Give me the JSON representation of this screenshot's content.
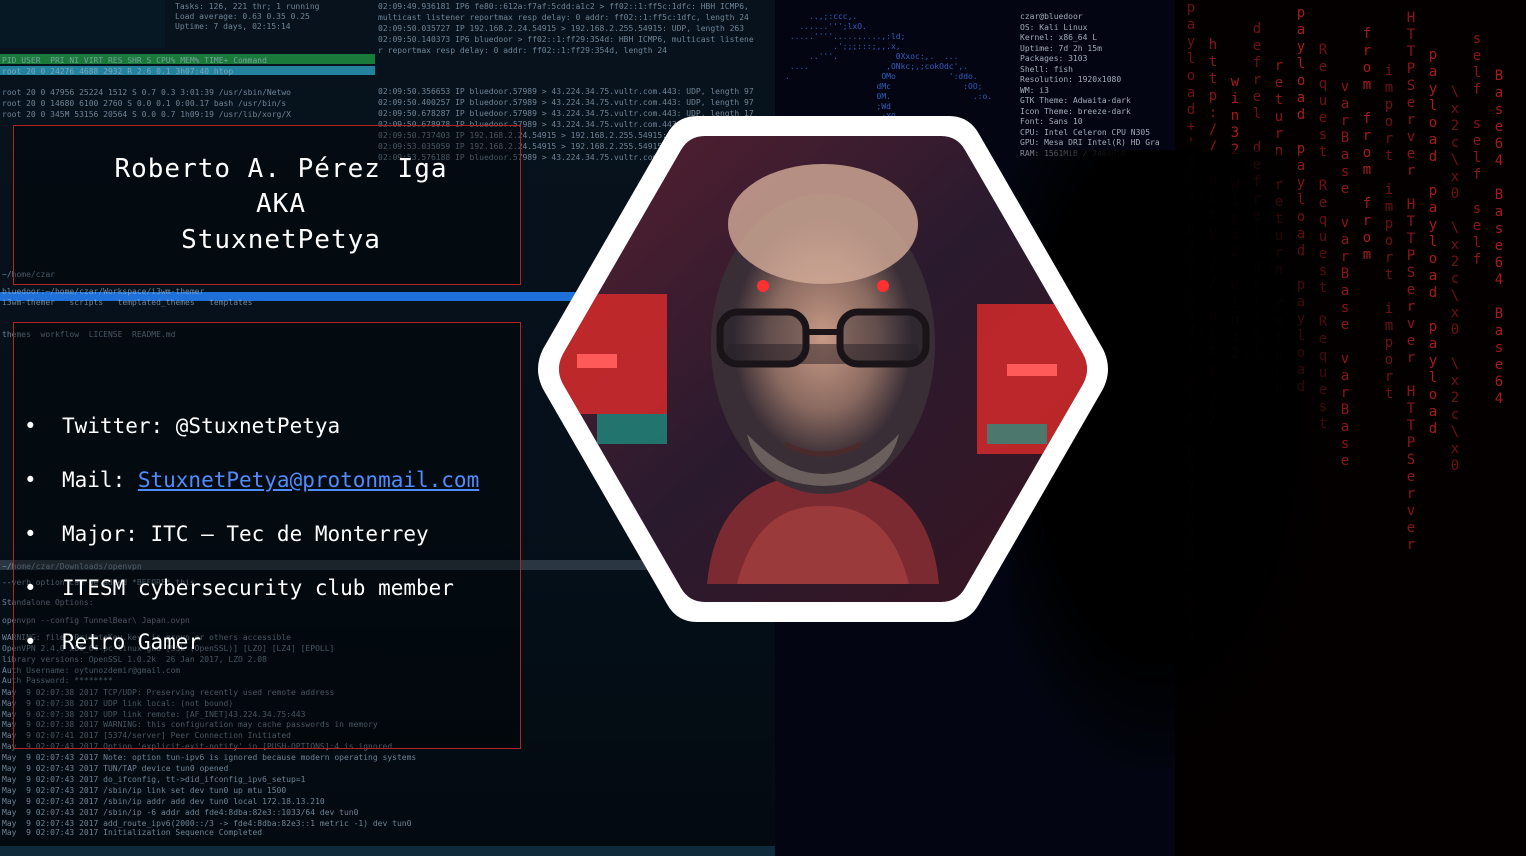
{
  "profile": {
    "name": "Roberto A. Pérez Iga",
    "aka_label": "AKA",
    "alias": "StuxnetPetya"
  },
  "info": [
    {
      "label": "Twitter: @StuxnetPetya",
      "link": ""
    },
    {
      "label": "Mail: ",
      "link": "StuxnetPetya@protonmail.com"
    },
    {
      "label": "Major: ITC – Tec de Monterrey",
      "link": ""
    },
    {
      "label": "ITESM cybersecurity club member",
      "link": ""
    },
    {
      "label": "Retro Gamer",
      "link": ""
    }
  ],
  "avatar": {
    "icon": "hacker-portrait-icon"
  },
  "colors": {
    "frame": "#b12424",
    "link": "#4f8cff",
    "matrix": "#c02020"
  },
  "background": {
    "terminal_lines": [
      "Tasks: 126, 221 thr; 1 running",
      "Load average: 0.63 0.35 0.25",
      "Uptime: 7 days, 02:15:14",
      "PID USER  PRI NI VIRT RES SHR S CPU% MEM% TIME+ Command",
      "root 20 0 24276 4688 2932 R 2.6 0.1 3h07:40 htop",
      "root 20 0 47956 25224 1512 S 0.7 0.3 3:01:39 /usr/sbin/Netwo",
      "root 20 0 14680 6100 2760 S 0.0 0.1 0:00.17 bash /usr/bin/s",
      "root 20 0 345M 53156 20564 S 0.0 0.7 1h09:19 /usr/lib/xorg/X",
      "~/home/czar",
      "bluedoor:~/home/czar/Workspace/i3wm-themer",
      "i3wm-themer   scripts   templated_themes   templates",
      "themes  workflow  LICENSE  README.md",
      "~/home/czar/Downloads/openvpn",
      "--verb option can be added *BEFORE* this.",
      "Standalone Options:",
      "openvpn --config TunnelBear\\ Japan.ovpn",
      "WARNING: file 'PrivateKey.key' is group or others accessible",
      "OpenVPN 2.4.0 x86_64-pc-linux-gnu [SSL (OpenSSL)] [LZO] [LZ4] [EPOLL]",
      "library versions: OpenSSL 1.0.2k  26 Jan 2017, LZO 2.08",
      "Auth Username: oytunozdemir@gmail.com",
      "Auth Password: ********",
      "May  9 02:07:38 2017 TCP/UDP: Preserving recently used remote address",
      "May  9 02:07:38 2017 UDP link local: (not bound)",
      "May  9 02:07:38 2017 UDP link remote: [AF_INET]43.224.34.75:443",
      "May  9 02:07:38 2017 WARNING: this configuration may cache passwords in memory",
      "May  9 02:07:41 2017 [5374/server] Peer Connection Initiated",
      "May  9 02:07:43 2017 Option 'explicit-exit-notify' in [PUSH-OPTIONS]:4 is ignored",
      "May  9 02:07:43 2017 Note: option tun-ipv6 is ignored because modern operating systems",
      "May  9 02:07:43 2017 TUN/TAP device tun0 opened",
      "May  9 02:07:43 2017 do_ifconfig, tt->did_ifconfig_ipv6_setup=1",
      "May  9 02:07:43 2017 /sbin/ip link set dev tun0 up mtu 1500",
      "May  9 02:07:43 2017 /sbin/ip addr add dev tun0 local 172.18.13.210",
      "May  9 02:07:43 2017 /sbin/ip -6 addr add fde4:8dba:82e3::1033/64 dev tun0",
      "May  9 02:07:43 2017 add_route_ipv6(2000::/3 -> fde4:8dba:82e3::1 metric -1) dev tun0",
      "May  9 02:07:43 2017 Initialization Sequence Completed"
    ],
    "tcpdump_lines": [
      "02:09:49.936181 IP6 fe80::612a:f7af:5cdd:a1c2 > ff02::1:ff5c:1dfc: HBH ICMP6,",
      "multicast listener reportmax resp delay: 0 addr: ff02::1:ff5c:1dfc, length 24",
      "02:09:50.035727 IP 192.168.2.24.54915 > 192.168.2.255.54915: UDP, length 263",
      "02:09:50.140373 IP6 bluedoor > ff02::1:ff29:354d: HBH ICMP6, multicast listene",
      "r reportmax resp delay: 0 addr: ff02::1:ff29:354d, length 24",
      "02:09:50.356653 IP bluedoor.57989 > 43.224.34.75.vultr.com.443: UDP, length 97",
      "02:09:50.400257 IP bluedoor.57989 > 43.224.34.75.vultr.com.443: UDP, length 97",
      "02:09:50.678287 IP bluedoor.57989 > 43.224.34.75.vultr.com.443: UDP, length 17",
      "02:09:50.678978 IP bluedoor.57989 > 43.224.34.75.vultr.com.443: UDP, length 97",
      "02:09:50.737403 IP 192.168.2.24.54915 > 192.168.2.255.54915: UDP, length 263",
      "02:09:53.035059 IP 192.168.2.24.54915 > 192.168.2.255.54915",
      "02:09:53.576188 IP bluedoor.57989 > 43.224.34.75.vultr.com.443"
    ],
    "neofetch_lines": [
      "czar@bluedoor",
      "OS: Kali Linux",
      "Kernel: x86_64 L",
      "Uptime: 7d 2h 15m",
      "Packages: 3103",
      "Shell: fish",
      "Resolution: 1920x1080",
      "WM: i3",
      "GTK Theme: Adwaita-dark",
      "Icon Theme: breeze-dark",
      "Font: Sans 10",
      "CPU: Intel Celeron CPU N305",
      "GPU: Mesa DRI Intel(R) HD Gra",
      "RAM: 1561MiB / 7404MiB"
    ],
    "matrix_columns": [
      "payload+'@\\x",
      "http://",
      "win32",
      "defrel",
      "return",
      "payload",
      "Request",
      "varBase",
      "from",
      "import",
      "HTTPServer",
      "payload",
      "\\x2c\\x0",
      "self",
      "Base64"
    ]
  }
}
